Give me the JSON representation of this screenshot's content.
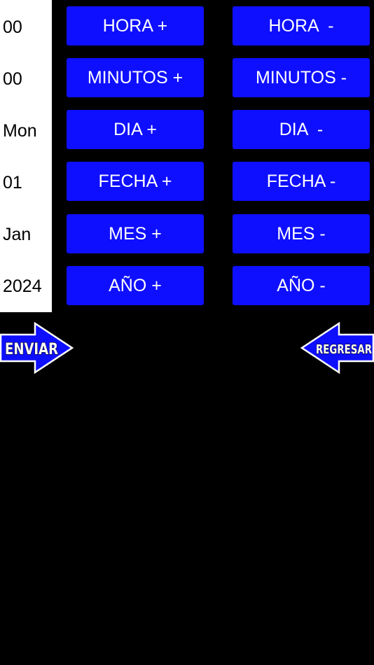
{
  "values": {
    "hour": "00",
    "minute": "00",
    "day": "Mon",
    "date": "01",
    "month": "Jan",
    "year": "2024"
  },
  "buttons": {
    "hour_plus": "HORA +",
    "hour_minus": "HORA  -",
    "minute_plus": "MINUTOS +",
    "minute_minus": "MINUTOS -",
    "day_plus": "DIA +",
    "day_minus": "DIA  -",
    "date_plus": "FECHA +",
    "date_minus": "FECHA -",
    "month_plus": "MES +",
    "month_minus": "MES -",
    "year_plus": "AÑO +",
    "year_minus": "AÑO -"
  },
  "nav": {
    "send_label": "ENVIAR",
    "back_label": "REGRESAR"
  },
  "colors": {
    "button_blue": "#0f0fff",
    "panel_white": "#ffffff",
    "background": "#000000"
  }
}
